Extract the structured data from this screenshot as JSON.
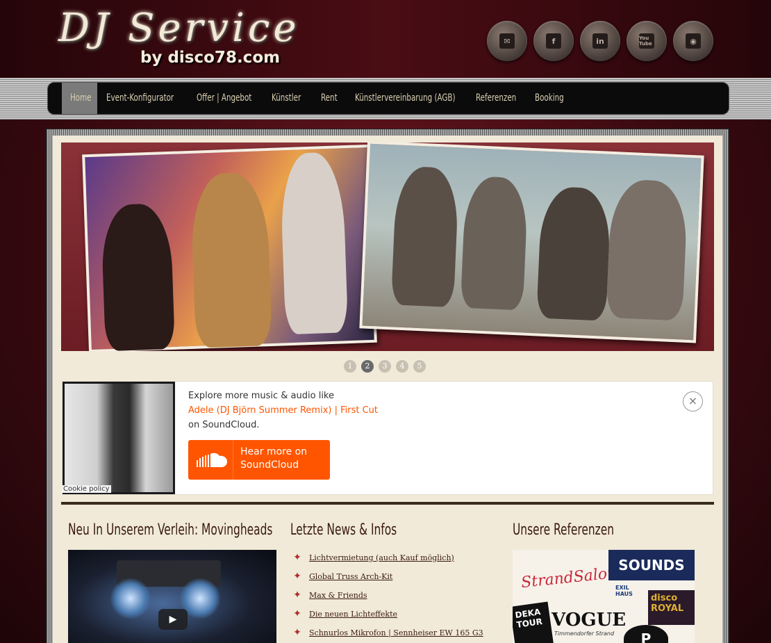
{
  "header": {
    "logo_title": "DJ Service",
    "logo_subtitle": "by disco78.com",
    "social": [
      {
        "name": "mail-icon",
        "glyph": "✉"
      },
      {
        "name": "facebook-icon",
        "glyph": "f"
      },
      {
        "name": "linkedin-icon",
        "glyph": "in"
      },
      {
        "name": "youtube-icon",
        "glyph": "You Tube"
      },
      {
        "name": "rss-icon",
        "glyph": "◉"
      }
    ]
  },
  "nav": {
    "items": [
      {
        "label": "Home"
      },
      {
        "label": "Event-Konfigurator"
      },
      {
        "label": "Offer | Angebot"
      },
      {
        "label": "Künstler"
      },
      {
        "label": "Rent"
      },
      {
        "label": "Künstlervereinbarung (AGB)"
      },
      {
        "label": "Referenzen"
      },
      {
        "label": "Booking"
      }
    ]
  },
  "slider": {
    "pages": [
      "1",
      "2",
      "3",
      "4",
      "5"
    ],
    "active_page": "2"
  },
  "soundcloud": {
    "explore_text": "Explore more music & audio like",
    "track_link": "Adele (DJ Björn Summer Remix) | First Cut",
    "on_text": "on SoundCloud.",
    "button_label_line1": "Hear more on",
    "button_label_line2": "SoundCloud",
    "cookie_policy": "Cookie policy",
    "close_glyph": "×"
  },
  "columns": {
    "video_title": "Neu In Unserem Verleih: Movingheads",
    "video_play_glyph": "▶",
    "news_title": "Letzte News & Infos",
    "news_items": [
      "Lichtvermietung (auch Kauf möglich)",
      "Global Truss Arch-Kit",
      "Max & Friends",
      "Die neuen Lichteffekte",
      "Schnurlos Mikrofon | Sennheiser EW 165 G3"
    ],
    "refs_title": "Unsere Referenzen",
    "refs_logos": [
      "StrandSalon",
      "SOUNDS",
      "EXIL HAUS",
      "disco ROYAL",
      "DEKA TOUR",
      "VOGUE",
      "Timmendorfer Strand",
      "P"
    ]
  },
  "colors": {
    "background": "#4a0d14",
    "content_bg": "#f1ead9",
    "nav_text": "#d9cfb2",
    "soundcloud_orange": "#ff5500"
  }
}
